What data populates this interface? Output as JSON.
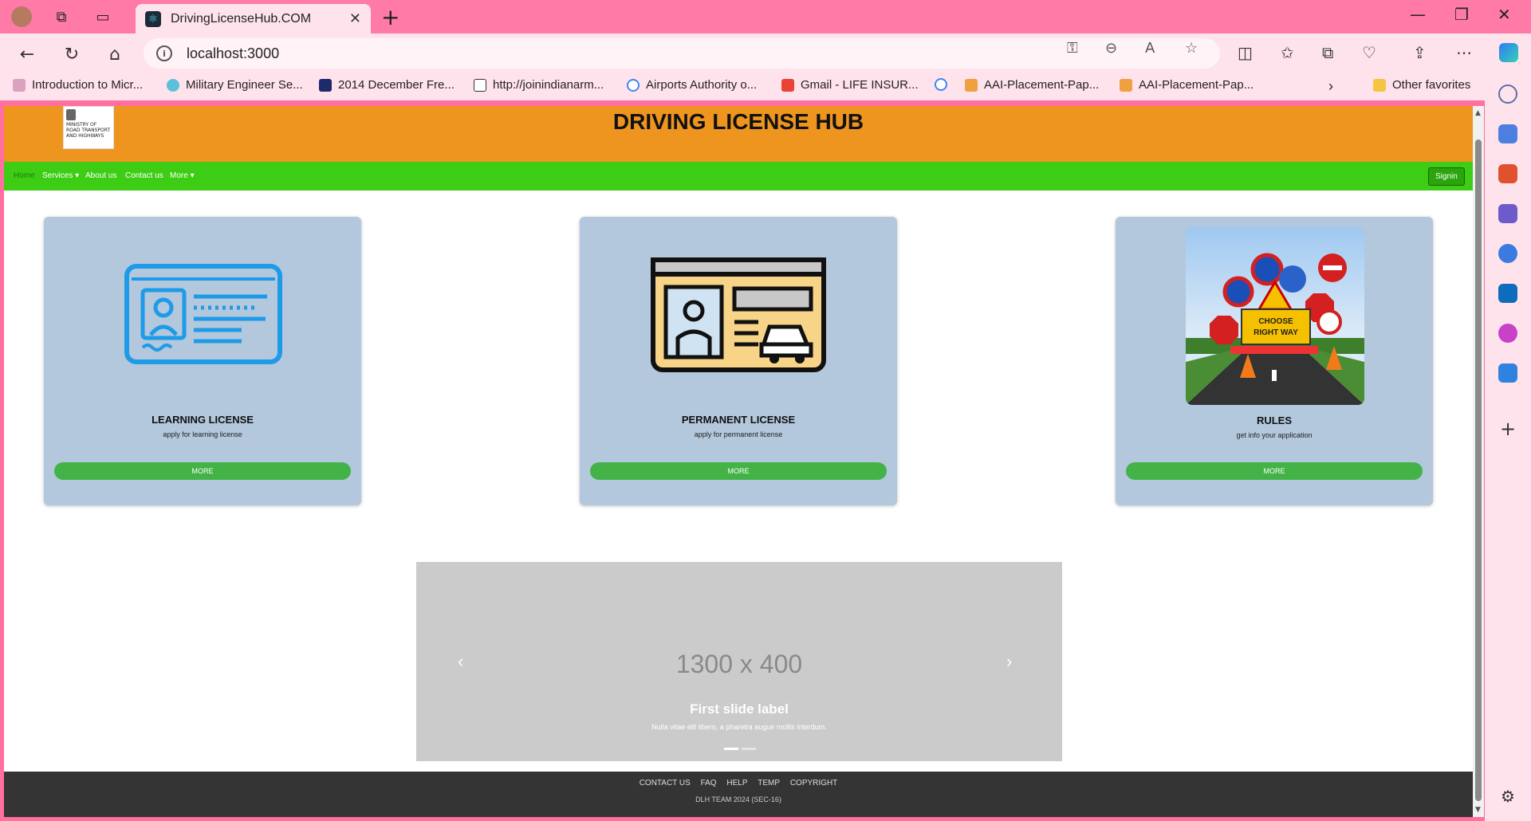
{
  "browser": {
    "tab_title": "DrivingLicenseHub.COM",
    "url": "localhost:3000",
    "favorites": [
      "Introduction to Micr...",
      "Military Engineer Se...",
      "2014 December Fre...",
      "http://joinindianarm...",
      "Airports Authority o...",
      "Gmail - LIFE INSUR...",
      "",
      "AAI-Placement-Pap...",
      "AAI-Placement-Pap..."
    ],
    "other_favorites": "Other favorites"
  },
  "site": {
    "title": "DRIVING LICENSE HUB",
    "logo_text": "MINISTRY OF ROAD TRANSPORT AND HIGHWAYS",
    "nav": {
      "home": "Home",
      "services": "Services",
      "about": "About us",
      "contact": "Contact us",
      "more": "More",
      "signin": "Signin"
    },
    "cards": [
      {
        "title": "LEARNING LICENSE",
        "subtitle": "apply for learning license",
        "button": "MORE"
      },
      {
        "title": "PERMANENT LICENSE",
        "subtitle": "apply for permanent license",
        "button": "MORE"
      },
      {
        "title": "RULES",
        "subtitle": "get info your application",
        "button": "MORE",
        "sign_text": "CHOOSE RIGHT WAY"
      }
    ],
    "carousel": {
      "size_text": "1300 x 400",
      "label": "First slide label",
      "caption": "Nulla vitae elit libero, a pharetra augue mollis interdum."
    },
    "footer": {
      "links": [
        "CONTACT US",
        "FAQ",
        "HELP",
        "TEMP",
        "COPYRIGHT"
      ],
      "copyright": "DLH TEAM 2024 (SEC-16)"
    }
  },
  "colors": {
    "header": "#ee951f",
    "nav": "#3ccd14",
    "card_bg": "#b3c7dd",
    "button": "#43b347",
    "footer": "#343434"
  }
}
